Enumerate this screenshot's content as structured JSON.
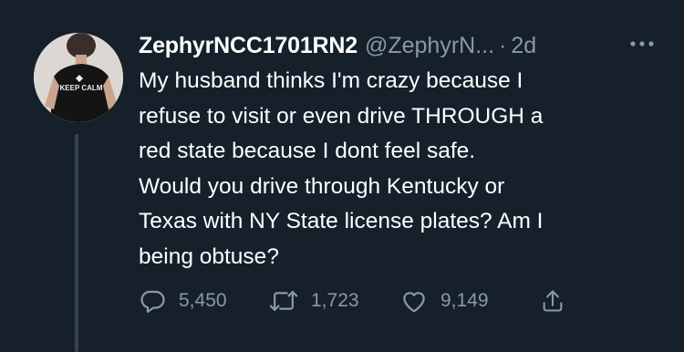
{
  "tweet": {
    "display_name": "ZephyrNCC1701RN2",
    "handle": "@ZephyrN...",
    "separator": "·",
    "time": "2d",
    "avatar_shirt_text": "KEEP CALM",
    "text_lines": [
      "My husband thinks I'm crazy because I",
      "refuse to visit or even drive THROUGH a",
      "red state because I dont feel safe.",
      "Would you drive through Kentucky or",
      "Texas with NY State license plates? Am I",
      "being obtuse?"
    ]
  },
  "actions": {
    "replies": "5,450",
    "retweets": "1,723",
    "likes": "9,149"
  },
  "icons": {
    "more": "more-horizontal-icon",
    "reply": "reply-icon",
    "retweet": "retweet-icon",
    "like": "heart-icon",
    "share": "share-icon"
  },
  "colors": {
    "background": "#15202b",
    "text": "#ffffff",
    "secondary_text": "#8b98a5",
    "thread_line": "#38444d"
  }
}
